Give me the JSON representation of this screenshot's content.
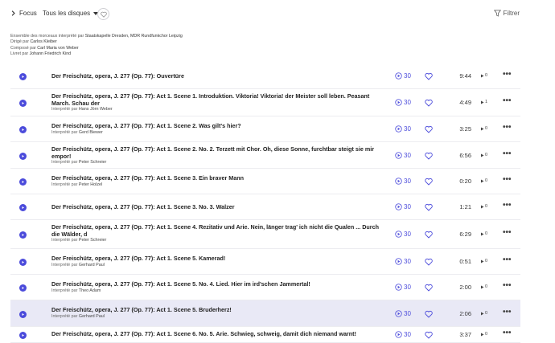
{
  "header": {
    "focus_label": "Focus",
    "disques_label": "Tous les disques",
    "filter_label": "Filtrer"
  },
  "credits": [
    {
      "label": "Ensemble des morceaux interprété par",
      "value": "Staatskapelle Dresden, MDR Rundfunkchor Leipzig"
    },
    {
      "label": "Dirigé par",
      "value": "Carlos Kleiber"
    },
    {
      "label": "Composé par",
      "value": "Carl Maria von Weber"
    },
    {
      "label": "Livret par",
      "value": "Johann Friedrich Kind"
    }
  ],
  "performer_prefix": "Interprété par",
  "tracks": [
    {
      "title": "Der Freischütz, opera, J. 277 (Op. 77): Ouvertüre",
      "performer": "",
      "sample": "30",
      "duration": "9:44",
      "plays": "0"
    },
    {
      "title": "Der Freischütz, opera, J. 277 (Op. 77): Act 1. Scene 1. Introduktion. Viktoria! Viktoria! der Meister soll leben. Peasant March. Schau der",
      "performer": "Hans Jörn Weber",
      "sample": "30",
      "duration": "4:49",
      "plays": "1"
    },
    {
      "title": "Der Freischütz, opera, J. 277 (Op. 77): Act 1. Scene 2. Was gilt's hier?",
      "performer": "Gerd Biewer",
      "sample": "30",
      "duration": "3:25",
      "plays": "0"
    },
    {
      "title": "Der Freischütz, opera, J. 277 (Op. 77): Act 1. Scene 2. No. 2. Terzett mit Chor. Oh, diese Sonne, furchtbar steigt sie mir empor!",
      "performer": "Peter Schreier",
      "sample": "30",
      "duration": "6:56",
      "plays": "0"
    },
    {
      "title": "Der Freischütz, opera, J. 277 (Op. 77): Act 1. Scene 3. Ein braver Mann",
      "performer": "Peter Holzel",
      "sample": "30",
      "duration": "0:20",
      "plays": "0"
    },
    {
      "title": "Der Freischütz, opera, J. 277 (Op. 77): Act 1. Scene 3. No. 3. Walzer",
      "performer": "",
      "sample": "30",
      "duration": "1:21",
      "plays": "0"
    },
    {
      "title": "Der Freischütz, opera, J. 277 (Op. 77): Act 1. Scene 4. Rezitativ und Arie. Nein, länger trag' ich nicht die Qualen ... Durch die Wälder, d",
      "performer": "Peter Schreier",
      "sample": "30",
      "duration": "6:29",
      "plays": "0"
    },
    {
      "title": "Der Freischütz, opera, J. 277 (Op. 77): Act 1. Scene 5. Kamerad!",
      "performer": "Gerhard Paul",
      "sample": "30",
      "duration": "0:51",
      "plays": "0"
    },
    {
      "title": "Der Freischütz, opera, J. 277 (Op. 77): Act 1. Scene 5. No. 4. Lied. Hier im ird'schen Jammertal!",
      "performer": "Theo Adam",
      "sample": "30",
      "duration": "2:00",
      "plays": "0"
    },
    {
      "title": "Der Freischütz, opera, J. 277 (Op. 77): Act 1. Scene 5. Bruderherz!",
      "performer": "Gerhard Paul",
      "sample": "30",
      "duration": "2:06",
      "plays": "0",
      "selected": true
    },
    {
      "title": "Der Freischütz, opera, J. 277 (Op. 77): Act 1. Scene 6. No. 5. Arie. Schwieg, schweig, damit dich niemand warnt!",
      "performer": "",
      "sample": "30",
      "duration": "3:37",
      "plays": "0"
    }
  ],
  "colors": {
    "accent": "#4b4bdb",
    "selected_row": "#e9e9f6"
  }
}
